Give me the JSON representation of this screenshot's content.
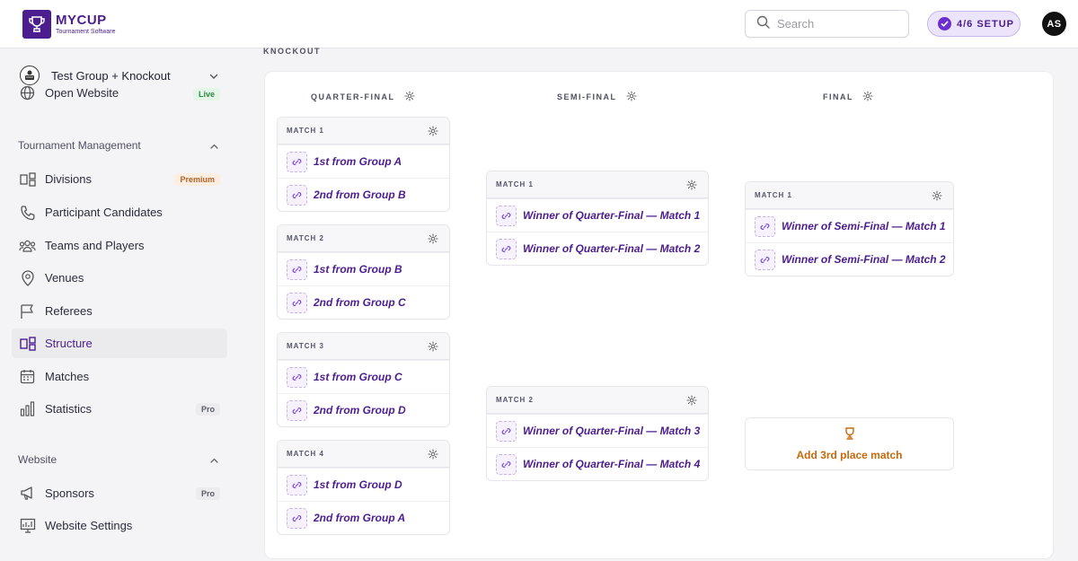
{
  "brand": {
    "name": "MYCUP",
    "tagline": "Tournament Software",
    "color": "#4b1d8f"
  },
  "search": {
    "placeholder": "Search"
  },
  "setup": {
    "label": "4/6  SETUP"
  },
  "user": {
    "initials": "AS"
  },
  "sidebar": {
    "tournament": "Test Group + Knockout",
    "open_website": {
      "label": "Open Website",
      "badge": "Live"
    },
    "sections": [
      {
        "title": "Tournament Management",
        "items": [
          {
            "label": "Divisions",
            "badge": "Premium",
            "icon": "divisions-icon"
          },
          {
            "label": "Participant Candidates",
            "icon": "phone-icon"
          },
          {
            "label": "Teams and Players",
            "icon": "team-icon"
          },
          {
            "label": "Venues",
            "icon": "location-pin-icon"
          },
          {
            "label": "Referees",
            "icon": "flag-icon"
          },
          {
            "label": "Structure",
            "icon": "structure-icon",
            "active": true
          },
          {
            "label": "Matches",
            "icon": "calendar-icon"
          },
          {
            "label": "Statistics",
            "badge": "Pro",
            "icon": "bar-chart-icon"
          }
        ]
      },
      {
        "title": "Website",
        "items": [
          {
            "label": "Sponsors",
            "badge": "Pro",
            "icon": "megaphone-icon"
          },
          {
            "label": "Website Settings",
            "icon": "settings-chart-icon"
          }
        ]
      }
    ]
  },
  "main": {
    "section_title": "KNOCKOUT",
    "rounds": [
      {
        "name": "QUARTER-FINAL",
        "matches": [
          {
            "title": "MATCH 1",
            "slots": [
              "1st from Group A",
              "2nd from Group B"
            ]
          },
          {
            "title": "MATCH 2",
            "slots": [
              "1st from Group B",
              "2nd from Group C"
            ]
          },
          {
            "title": "MATCH 3",
            "slots": [
              "1st from Group C",
              "2nd from Group D"
            ]
          },
          {
            "title": "MATCH 4",
            "slots": [
              "1st from Group D",
              "2nd from Group A"
            ]
          }
        ]
      },
      {
        "name": "SEMI-FINAL",
        "matches": [
          {
            "title": "MATCH 1",
            "slots": [
              "Winner of Quarter-Final — Match 1",
              "Winner of Quarter-Final — Match 2"
            ]
          },
          {
            "title": "MATCH 2",
            "slots": [
              "Winner of Quarter-Final — Match 3",
              "Winner of Quarter-Final — Match 4"
            ]
          }
        ]
      },
      {
        "name": "FINAL",
        "matches": [
          {
            "title": "MATCH 1",
            "slots": [
              "Winner of Semi-Final — Match 1",
              "Winner of Semi-Final — Match 2"
            ]
          }
        ]
      }
    ],
    "add_third_place": "Add 3rd place match"
  }
}
